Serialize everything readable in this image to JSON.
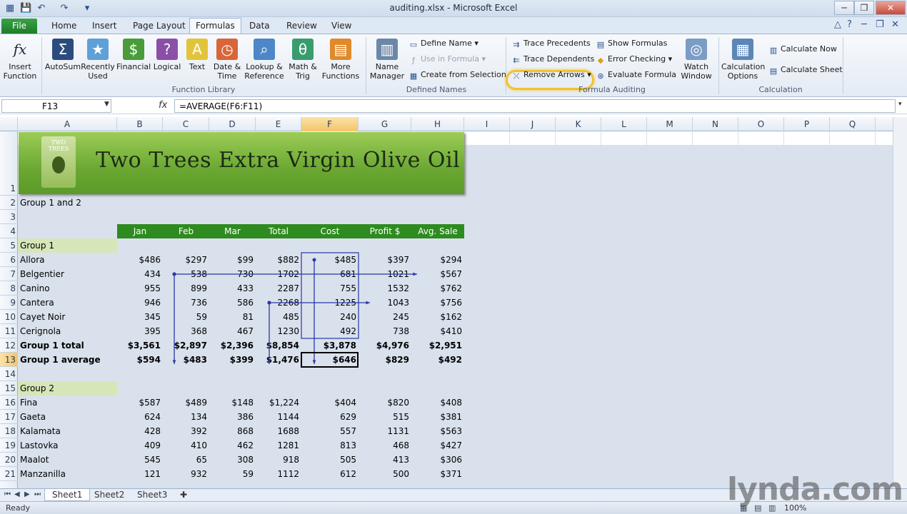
{
  "window": {
    "title": "auditing.xlsx - Microsoft Excel",
    "min": "─",
    "restore": "❐",
    "close": "✕"
  },
  "tabs": {
    "file": "File",
    "items": [
      "Home",
      "Insert",
      "Page Layout",
      "Formulas",
      "Data",
      "Review",
      "View"
    ],
    "active": "Formulas"
  },
  "ribbon": {
    "insert_function": "Insert Function",
    "library": [
      {
        "label": "AutoSum",
        "icon": "Σ",
        "color": "#2b4c7e"
      },
      {
        "label": "Recently Used",
        "icon": "★",
        "color": "#5fa0d8"
      },
      {
        "label": "Financial",
        "icon": "$",
        "color": "#4a9c3a"
      },
      {
        "label": "Logical",
        "icon": "?",
        "color": "#8b4fa8"
      },
      {
        "label": "Text",
        "icon": "A",
        "color": "#e2c43a"
      },
      {
        "label": "Date & Time",
        "icon": "◷",
        "color": "#d9663a"
      },
      {
        "label": "Lookup & Reference",
        "icon": "⌕",
        "color": "#4d87c7"
      },
      {
        "label": "Math & Trig",
        "icon": "θ",
        "color": "#3a9c6e"
      },
      {
        "label": "More Functions",
        "icon": "▤",
        "color": "#e08a2c"
      }
    ],
    "function_library_label": "Function Library",
    "name_manager": "Name Manager",
    "define_name": "Define Name",
    "use_in_formula": "Use in Formula",
    "create_from_selection": "Create from Selection",
    "defined_names_label": "Defined Names",
    "trace_precedents": "Trace Precedents",
    "trace_dependents": "Trace Dependents",
    "remove_arrows": "Remove Arrows",
    "show_formulas": "Show Formulas",
    "error_checking": "Error Checking",
    "evaluate_formula": "Evaluate Formula",
    "watch_window": "Watch Window",
    "formula_auditing_label": "Formula Auditing",
    "calculation_options": "Calculation Options",
    "calculate_now": "Calculate Now",
    "calculate_sheet": "Calculate Sheet",
    "calculation_label": "Calculation"
  },
  "formula_bar": {
    "name_box": "F13",
    "fx": "fx",
    "formula": "=AVERAGE(F6:F11)"
  },
  "columns": [
    "A",
    "B",
    "C",
    "D",
    "E",
    "F",
    "G",
    "H",
    "I",
    "J",
    "K",
    "L",
    "M",
    "N",
    "O",
    "P",
    "Q"
  ],
  "rows": [
    "1",
    "2",
    "3",
    "4",
    "5",
    "6",
    "7",
    "8",
    "9",
    "10",
    "11",
    "12",
    "13",
    "14",
    "15",
    "16",
    "17",
    "18",
    "19",
    "20",
    "21"
  ],
  "banner": {
    "title": "Two Trees Extra Virgin Olive Oil",
    "logo_text": "TWO TREES"
  },
  "sheet": {
    "a2": "Group 1 and 2",
    "headers": [
      "Jan",
      "Feb",
      "Mar",
      "Total",
      "Cost",
      "Profit $",
      "Avg. Sale"
    ],
    "group1_label": "Group 1",
    "group1": [
      {
        "name": "Allora",
        "v": [
          "$486",
          "$297",
          "$99",
          "$882",
          "$485",
          "$397",
          "$294"
        ]
      },
      {
        "name": "Belgentier",
        "v": [
          "434",
          "538",
          "730",
          "1702",
          "681",
          "1021",
          "$567"
        ]
      },
      {
        "name": "Canino",
        "v": [
          "955",
          "899",
          "433",
          "2287",
          "755",
          "1532",
          "$762"
        ]
      },
      {
        "name": "Cantera",
        "v": [
          "946",
          "736",
          "586",
          "2268",
          "1225",
          "1043",
          "$756"
        ]
      },
      {
        "name": "Cayet Noir",
        "v": [
          "345",
          "59",
          "81",
          "485",
          "240",
          "245",
          "$162"
        ]
      },
      {
        "name": "Cerignola",
        "v": [
          "395",
          "368",
          "467",
          "1230",
          "492",
          "738",
          "$410"
        ]
      }
    ],
    "total": {
      "name": "Group 1 total",
      "v": [
        "$3,561",
        "$2,897",
        "$2,396",
        "$8,854",
        "$3,878",
        "$4,976",
        "$2,951"
      ]
    },
    "average": {
      "name": "Group 1 average",
      "v": [
        "$594",
        "$483",
        "$399",
        "$1,476",
        "$646",
        "$829",
        "$492"
      ]
    },
    "group2_label": "Group 2",
    "group2": [
      {
        "name": "Fina",
        "v": [
          "$587",
          "$489",
          "$148",
          "$1,224",
          "$404",
          "$820",
          "$408"
        ]
      },
      {
        "name": "Gaeta",
        "v": [
          "624",
          "134",
          "386",
          "1144",
          "629",
          "515",
          "$381"
        ]
      },
      {
        "name": "Kalamata",
        "v": [
          "428",
          "392",
          "868",
          "1688",
          "557",
          "1131",
          "$563"
        ]
      },
      {
        "name": "Lastovka",
        "v": [
          "409",
          "410",
          "462",
          "1281",
          "813",
          "468",
          "$427"
        ]
      },
      {
        "name": "Maalot",
        "v": [
          "545",
          "65",
          "308",
          "918",
          "505",
          "413",
          "$306"
        ]
      },
      {
        "name": "Manzanilla",
        "v": [
          "121",
          "932",
          "59",
          "1112",
          "612",
          "500",
          "$371"
        ]
      }
    ]
  },
  "sheet_tabs": [
    "Sheet1",
    "Sheet2",
    "Sheet3"
  ],
  "status": {
    "ready": "Ready",
    "zoom": "100%"
  },
  "watermark": "lynda.com"
}
